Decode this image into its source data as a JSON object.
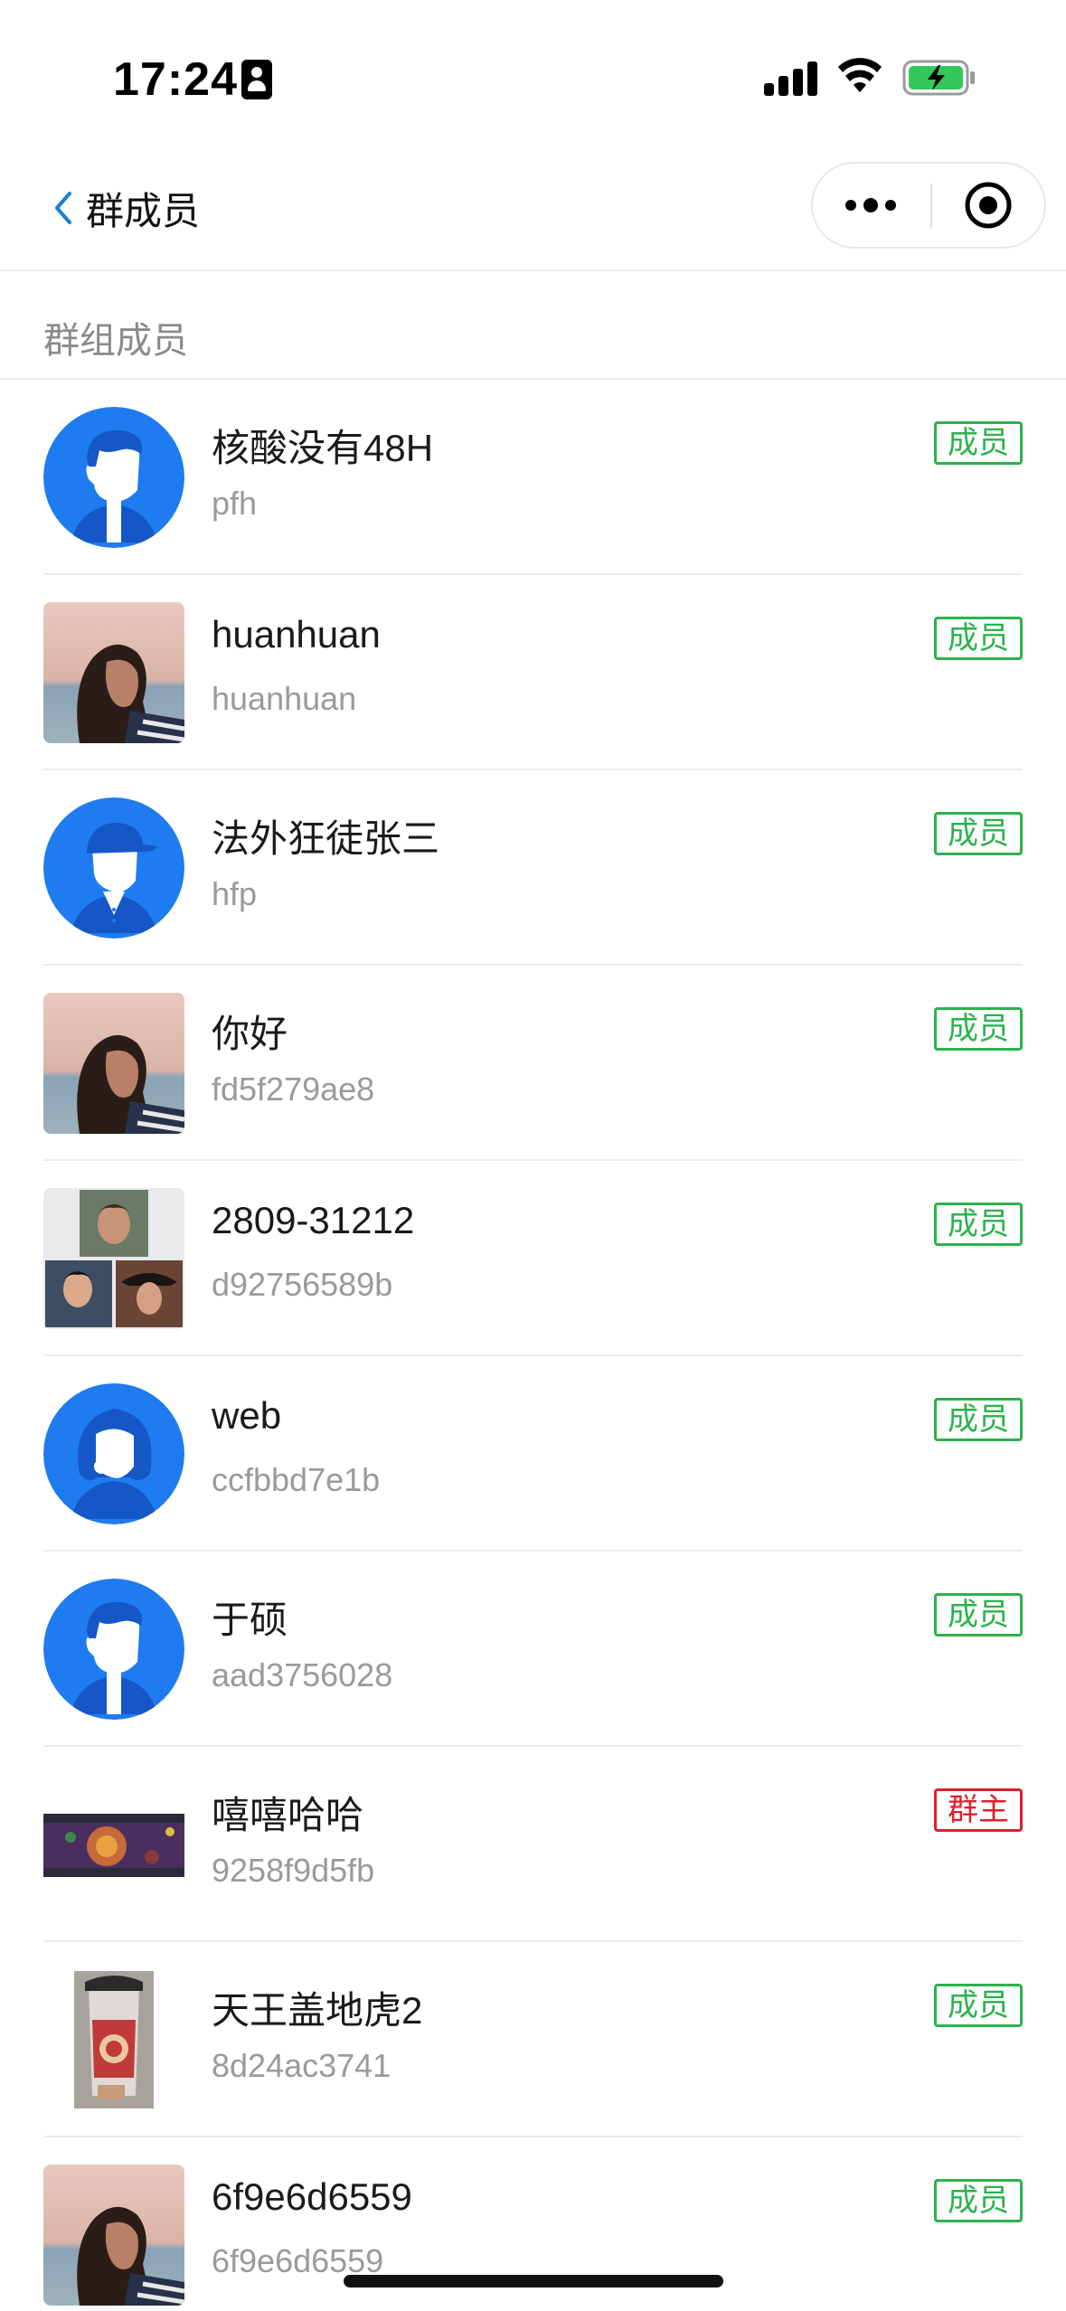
{
  "status_bar": {
    "time": "17:24"
  },
  "nav": {
    "title": "群成员"
  },
  "section": {
    "title": "群组成员"
  },
  "members": [
    {
      "name": "核酸没有48H",
      "id": "pfh",
      "role": "成员",
      "avatar": "default-male-avatar",
      "avatar_shape": "round"
    },
    {
      "name": "huanhuan",
      "id": "huanhuan",
      "role": "成员",
      "avatar": "woman-beach-photo",
      "avatar_shape": "square"
    },
    {
      "name": "法外狂徒张三",
      "id": "hfp",
      "role": "成员",
      "avatar": "default-cap-avatar",
      "avatar_shape": "round"
    },
    {
      "name": "你好",
      "id": "fd5f279ae8",
      "role": "成员",
      "avatar": "woman-beach-photo",
      "avatar_shape": "square"
    },
    {
      "name": "2809-31212",
      "id": "d92756589b",
      "role": "成员",
      "avatar": "group-collage-photo",
      "avatar_shape": "square"
    },
    {
      "name": "web",
      "id": "ccfbbd7e1b",
      "role": "成员",
      "avatar": "default-female-avatar",
      "avatar_shape": "round"
    },
    {
      "name": "于硕",
      "id": "aad3756028",
      "role": "成员",
      "avatar": "default-male-avatar",
      "avatar_shape": "round"
    },
    {
      "name": "嘻嘻哈哈",
      "id": "9258f9d5fb",
      "role": "群主",
      "avatar": "game-screenshot-photo",
      "avatar_shape": "square"
    },
    {
      "name": "天王盖地虎2",
      "id": "8d24ac3741",
      "role": "成员",
      "avatar": "drink-cup-photo",
      "avatar_shape": "square"
    },
    {
      "name": "6f9e6d6559",
      "id": "6f9e6d6559",
      "role": "成员",
      "avatar": "woman-beach-photo",
      "avatar_shape": "square"
    }
  ],
  "colors": {
    "member_badge": "#2bb24c",
    "owner_badge": "#e0202c",
    "avatar_blue": "#1e7bf0",
    "back_chevron": "#1a7fd6"
  }
}
